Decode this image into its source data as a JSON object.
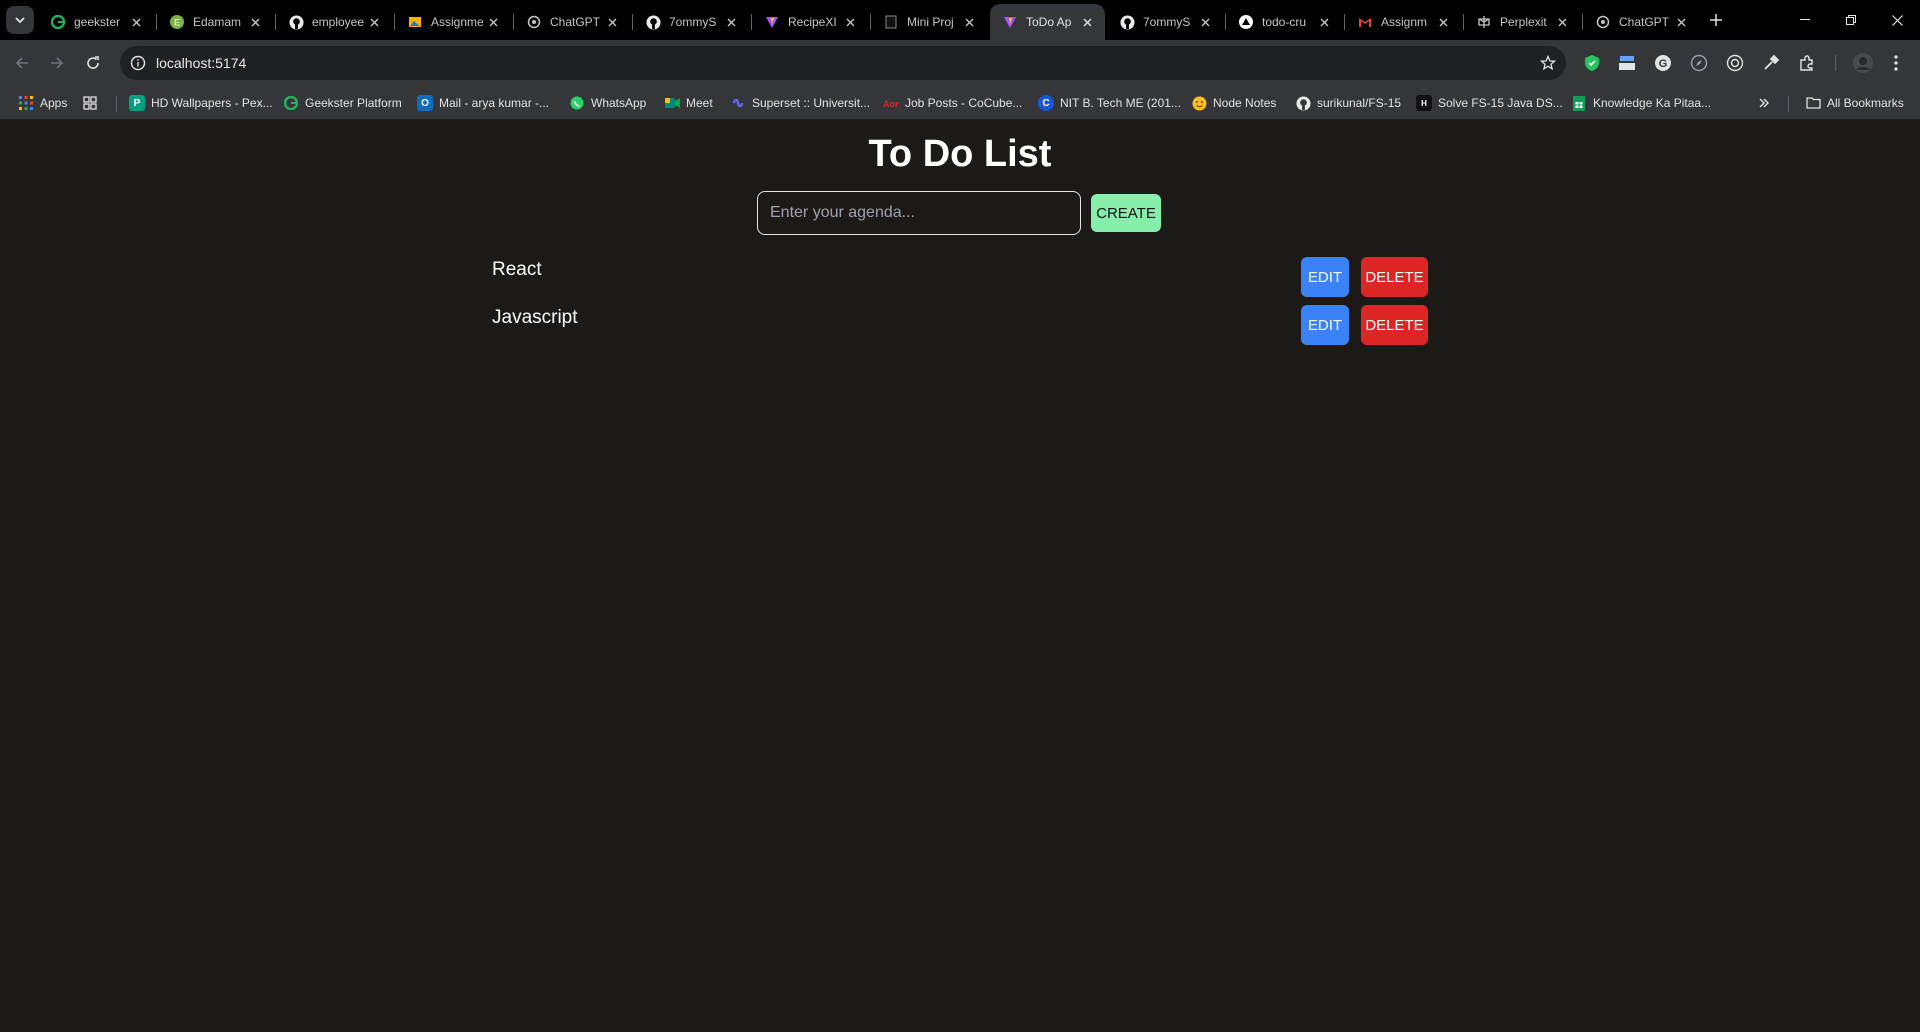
{
  "browser": {
    "tabs": [
      {
        "title": "geekster",
        "icon": "geekster-icon",
        "active": false
      },
      {
        "title": "Edamam",
        "icon": "edamam-icon",
        "active": false
      },
      {
        "title": "employee",
        "icon": "github-icon",
        "active": false
      },
      {
        "title": "Assignme",
        "icon": "image-icon",
        "active": false
      },
      {
        "title": "ChatGPT",
        "icon": "chatgpt-icon",
        "active": false
      },
      {
        "title": "7ommyS",
        "icon": "github-icon",
        "active": false
      },
      {
        "title": "RecipeXI",
        "icon": "vite-icon",
        "active": false
      },
      {
        "title": "Mini Proj",
        "icon": "document-icon",
        "active": false
      },
      {
        "title": "ToDo Ap",
        "icon": "vite-icon",
        "active": true
      },
      {
        "title": "7ommyS",
        "icon": "github-icon",
        "active": false
      },
      {
        "title": "todo-cru",
        "icon": "vercel-icon",
        "active": false
      },
      {
        "title": "Assignm",
        "icon": "gmail-icon",
        "active": false
      },
      {
        "title": "Perplexit",
        "icon": "perplexity-icon",
        "active": false
      },
      {
        "title": "ChatGPT",
        "icon": "chatgpt-icon",
        "active": false
      }
    ],
    "url": "localhost:5174",
    "bookmarks": [
      {
        "label": "Apps",
        "icon": "apps-grid-icon"
      },
      {
        "label": "",
        "icon": "tab-groups-icon"
      },
      {
        "label": "HD Wallpapers - Pex...",
        "icon": "pexels-icon"
      },
      {
        "label": "Geekster Platform",
        "icon": "geekster-icon"
      },
      {
        "label": "Mail - arya kumar -...",
        "icon": "outlook-icon"
      },
      {
        "label": "WhatsApp",
        "icon": "whatsapp-icon"
      },
      {
        "label": "Meet",
        "icon": "meet-icon"
      },
      {
        "label": "Superset :: Universit...",
        "icon": "superset-icon"
      },
      {
        "label": "Job Posts - CoCube...",
        "icon": "cocubes-icon"
      },
      {
        "label": "NIT B. Tech ME (201...",
        "icon": "c-icon"
      },
      {
        "label": "Node Notes",
        "icon": "emoji-icon"
      },
      {
        "label": "surikunal/FS-15",
        "icon": "github-icon"
      },
      {
        "label": "Solve FS-15 Java DS...",
        "icon": "hackerrank-icon"
      },
      {
        "label": "Knowledge Ka Pitaa...",
        "icon": "sheets-icon"
      }
    ],
    "all_bookmarks_label": "All Bookmarks"
  },
  "app": {
    "title": "To Do List",
    "input_placeholder": "Enter your agenda...",
    "input_value": "",
    "create_label": "CREATE",
    "todos": [
      {
        "text": "React",
        "edit_label": "EDIT",
        "delete_label": "DELETE"
      },
      {
        "text": "Javascript",
        "edit_label": "EDIT",
        "delete_label": "DELETE"
      }
    ]
  },
  "colors": {
    "page_background": "#1c1917",
    "create_button": "#86efac",
    "edit_button": "#3b82f6",
    "delete_button": "#dc2626"
  }
}
